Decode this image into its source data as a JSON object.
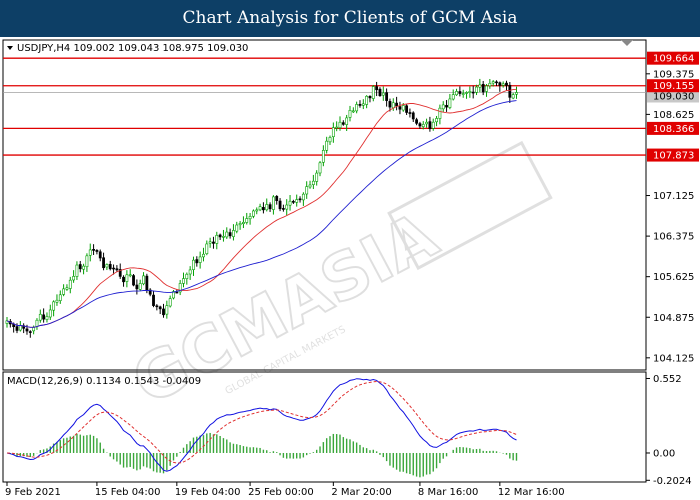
{
  "header": {
    "title": "Chart Analysis for Clients of GCM Asia"
  },
  "colors": {
    "header_bg": "#0d3f66",
    "bull": "#00a000",
    "bear": "#000000",
    "ma_fast": "#e03030",
    "ma_slow": "#2020d0",
    "level_line": "#e00000",
    "price_tag": "#e00000",
    "macd_line": "#1010e0",
    "macd_signal": "#e03030",
    "macd_hist": "#3aa63a"
  },
  "chart_data": [
    {
      "type": "candlestick",
      "symbol_line": "USDJPY,H4  109.002 109.043 108.975 109.030",
      "y_tick_labels": [
        "109.375",
        "108.625",
        "107.125",
        "106.375",
        "105.625",
        "104.875",
        "104.125"
      ],
      "y_ticks": [
        109.375,
        108.625,
        107.125,
        106.375,
        105.625,
        104.875,
        104.125
      ],
      "ylim": [
        103.9,
        110.0
      ],
      "current_price_label": "109.030",
      "current_price": 109.03,
      "levels": [
        {
          "label": "109.664",
          "value": 109.664
        },
        {
          "label": "109.155",
          "value": 109.155
        },
        {
          "label": "108.366",
          "value": 108.366
        },
        {
          "label": "107.873",
          "value": 107.873
        }
      ],
      "x_tick_labels": [
        "9 Feb 2021",
        "15 Feb 04:00",
        "19 Feb 04:00",
        "25 Feb 00:00",
        "2 Mar 20:00",
        "8 Mar 16:00",
        "12 Mar 16:00"
      ],
      "x_tick_index": [
        0,
        27,
        51,
        73,
        98,
        124,
        148
      ],
      "closes": [
        104.81,
        104.75,
        104.7,
        104.63,
        104.72,
        104.67,
        104.62,
        104.61,
        104.69,
        104.82,
        104.93,
        104.84,
        104.89,
        105.01,
        105.16,
        105.19,
        105.29,
        105.4,
        105.42,
        105.56,
        105.63,
        105.84,
        105.77,
        105.82,
        106.01,
        106.12,
        106.11,
        106.09,
        105.97,
        105.79,
        105.85,
        105.77,
        105.77,
        105.75,
        105.63,
        105.53,
        105.66,
        105.66,
        105.47,
        105.4,
        105.5,
        105.64,
        105.37,
        105.3,
        105.09,
        105.07,
        105.03,
        104.92,
        105.09,
        105.22,
        105.35,
        105.34,
        105.5,
        105.59,
        105.67,
        105.75,
        105.93,
        105.88,
        105.99,
        106.04,
        106.23,
        106.27,
        106.24,
        106.39,
        106.36,
        106.37,
        106.45,
        106.38,
        106.48,
        106.58,
        106.61,
        106.63,
        106.7,
        106.74,
        106.84,
        106.86,
        106.92,
        106.86,
        106.96,
        106.88,
        107.1,
        107.03,
        106.88,
        106.87,
        106.95,
        107.02,
        107.01,
        107.05,
        107.05,
        107.15,
        107.29,
        107.32,
        107.39,
        107.54,
        107.73,
        107.96,
        108.13,
        108.2,
        108.38,
        108.39,
        108.48,
        108.44,
        108.56,
        108.7,
        108.69,
        108.81,
        108.79,
        108.82,
        108.96,
        108.93,
        109.14,
        109.08,
        108.97,
        109.02,
        108.88,
        108.76,
        108.84,
        108.78,
        108.72,
        108.79,
        108.66,
        108.64,
        108.54,
        108.46,
        108.41,
        108.44,
        108.48,
        108.36,
        108.48,
        108.55,
        108.74,
        108.8,
        108.76,
        108.91,
        108.99,
        109.05,
        109.01,
        109.01,
        109.03,
        109.05,
        109.02,
        109.13,
        109.17,
        109.04,
        109.15,
        109.2,
        109.23,
        109.22,
        109.16,
        109.19,
        109.16,
        108.94,
        108.99,
        109.03
      ]
    },
    {
      "type": "macd",
      "label": "MACD(12,26,9)  0.1134  0.1543  -0.0409",
      "y_tick_labels": [
        "0.552",
        "0.00",
        "-0.2024"
      ],
      "y_ticks": [
        0.552,
        0.0,
        -0.2024
      ],
      "ylim": [
        -0.215,
        0.6
      ]
    }
  ]
}
